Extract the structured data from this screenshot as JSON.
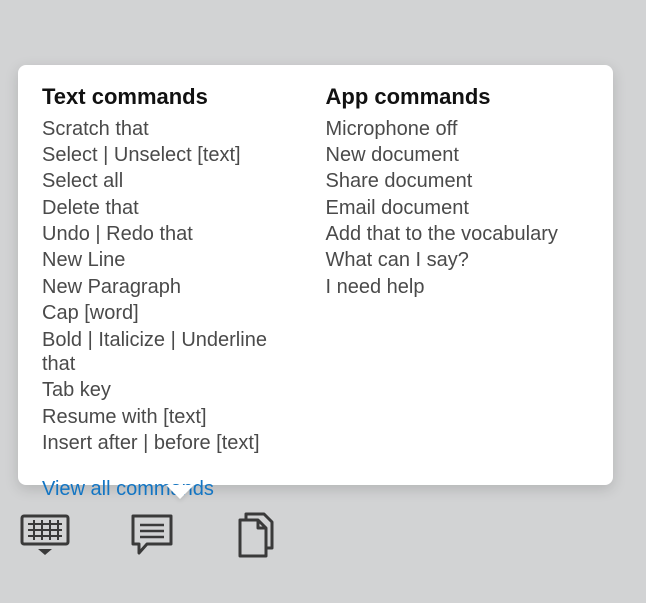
{
  "popup": {
    "text_commands": {
      "heading": "Text commands",
      "items": [
        "Scratch that",
        "Select | Unselect [text]",
        "Select all",
        "Delete that",
        "Undo | Redo that",
        "New Line",
        "New Paragraph",
        "Cap [word]",
        "Bold | Italicize | Underline that",
        "Tab key",
        "Resume with [text]",
        "Insert after | before [text]"
      ]
    },
    "app_commands": {
      "heading": "App commands",
      "items": [
        "Microphone off",
        "New document",
        "Share document",
        "Email document",
        "Add that to the vocabulary",
        "What can I say?",
        "I need help"
      ]
    },
    "view_all_label": "View all commands"
  },
  "toolbar": {
    "keyboard_label": "keyboard",
    "commands_label": "commands",
    "documents_label": "documents"
  }
}
